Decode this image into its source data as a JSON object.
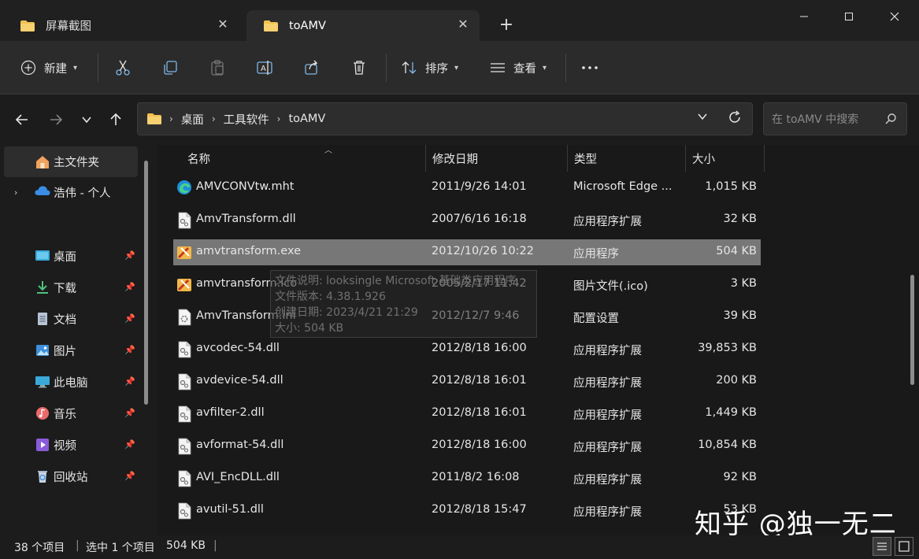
{
  "tabs": [
    {
      "label": "屏幕截图",
      "active": false
    },
    {
      "label": "toAMV",
      "active": true
    }
  ],
  "toolbar": {
    "new_label": "新建",
    "sort_label": "排序",
    "view_label": "查看"
  },
  "address": {
    "crumbs": [
      "桌面",
      "工具软件",
      "toAMV"
    ]
  },
  "search": {
    "placeholder": "在 toAMV 中搜索"
  },
  "sidebar": {
    "home": "主文件夹",
    "onedrive": "浩伟 - 个人",
    "items": [
      {
        "label": "桌面",
        "icon": "desktop-icon"
      },
      {
        "label": "下载",
        "icon": "download-icon"
      },
      {
        "label": "文档",
        "icon": "document-icon"
      },
      {
        "label": "图片",
        "icon": "pictures-icon"
      },
      {
        "label": "此电脑",
        "icon": "computer-icon"
      },
      {
        "label": "音乐",
        "icon": "music-icon"
      },
      {
        "label": "视频",
        "icon": "video-icon"
      },
      {
        "label": "回收站",
        "icon": "recycle-bin-icon"
      }
    ]
  },
  "columns": {
    "name": "名称",
    "date": "修改日期",
    "type": "类型",
    "size": "大小"
  },
  "files": [
    {
      "name": "AMVCONVtw.mht",
      "date": "2011/9/26 14:01",
      "type": "Microsoft Edge ...",
      "size": "1,015 KB",
      "icon": "edge-icon"
    },
    {
      "name": "AmvTransform.dll",
      "date": "2007/6/16 16:18",
      "type": "应用程序扩展",
      "size": "32 KB",
      "icon": "dll-icon"
    },
    {
      "name": "amvtransform.exe",
      "date": "2012/10/26 10:22",
      "type": "应用程序",
      "size": "504 KB",
      "icon": "exe-icon",
      "selected": true
    },
    {
      "name": "amvtransform.ico",
      "date": "2005/2/17 11:42",
      "type": "图片文件(.ico)",
      "size": "3 KB",
      "icon": "ico-icon"
    },
    {
      "name": "AmvTransform.ini",
      "date": "2012/12/7 9:46",
      "type": "配置设置",
      "size": "39 KB",
      "icon": "ini-icon"
    },
    {
      "name": "avcodec-54.dll",
      "date": "2012/8/18 16:00",
      "type": "应用程序扩展",
      "size": "39,853 KB",
      "icon": "dll-icon"
    },
    {
      "name": "avdevice-54.dll",
      "date": "2012/8/18 16:01",
      "type": "应用程序扩展",
      "size": "200 KB",
      "icon": "dll-icon"
    },
    {
      "name": "avfilter-2.dll",
      "date": "2012/8/18 16:01",
      "type": "应用程序扩展",
      "size": "1,449 KB",
      "icon": "dll-icon"
    },
    {
      "name": "avformat-54.dll",
      "date": "2012/8/18 16:00",
      "type": "应用程序扩展",
      "size": "10,854 KB",
      "icon": "dll-icon"
    },
    {
      "name": "AVI_EncDLL.dll",
      "date": "2011/8/2 16:08",
      "type": "应用程序扩展",
      "size": "92 KB",
      "icon": "dll-icon"
    },
    {
      "name": "avutil-51.dll",
      "date": "2012/8/18 15:47",
      "type": "应用程序扩展",
      "size": "53 KB",
      "icon": "dll-icon"
    }
  ],
  "tooltip": {
    "lines": [
      "文件说明: looksingle Microsoft 基础类应用程序",
      "文件版本: 4.38.1.926",
      "创建日期: 2023/4/21 21:29",
      "大小: 504 KB"
    ]
  },
  "status": {
    "count": "38 个项目",
    "selection": "选中 1 个项目",
    "size": "504 KB"
  },
  "watermark": "知乎 @独一无二"
}
